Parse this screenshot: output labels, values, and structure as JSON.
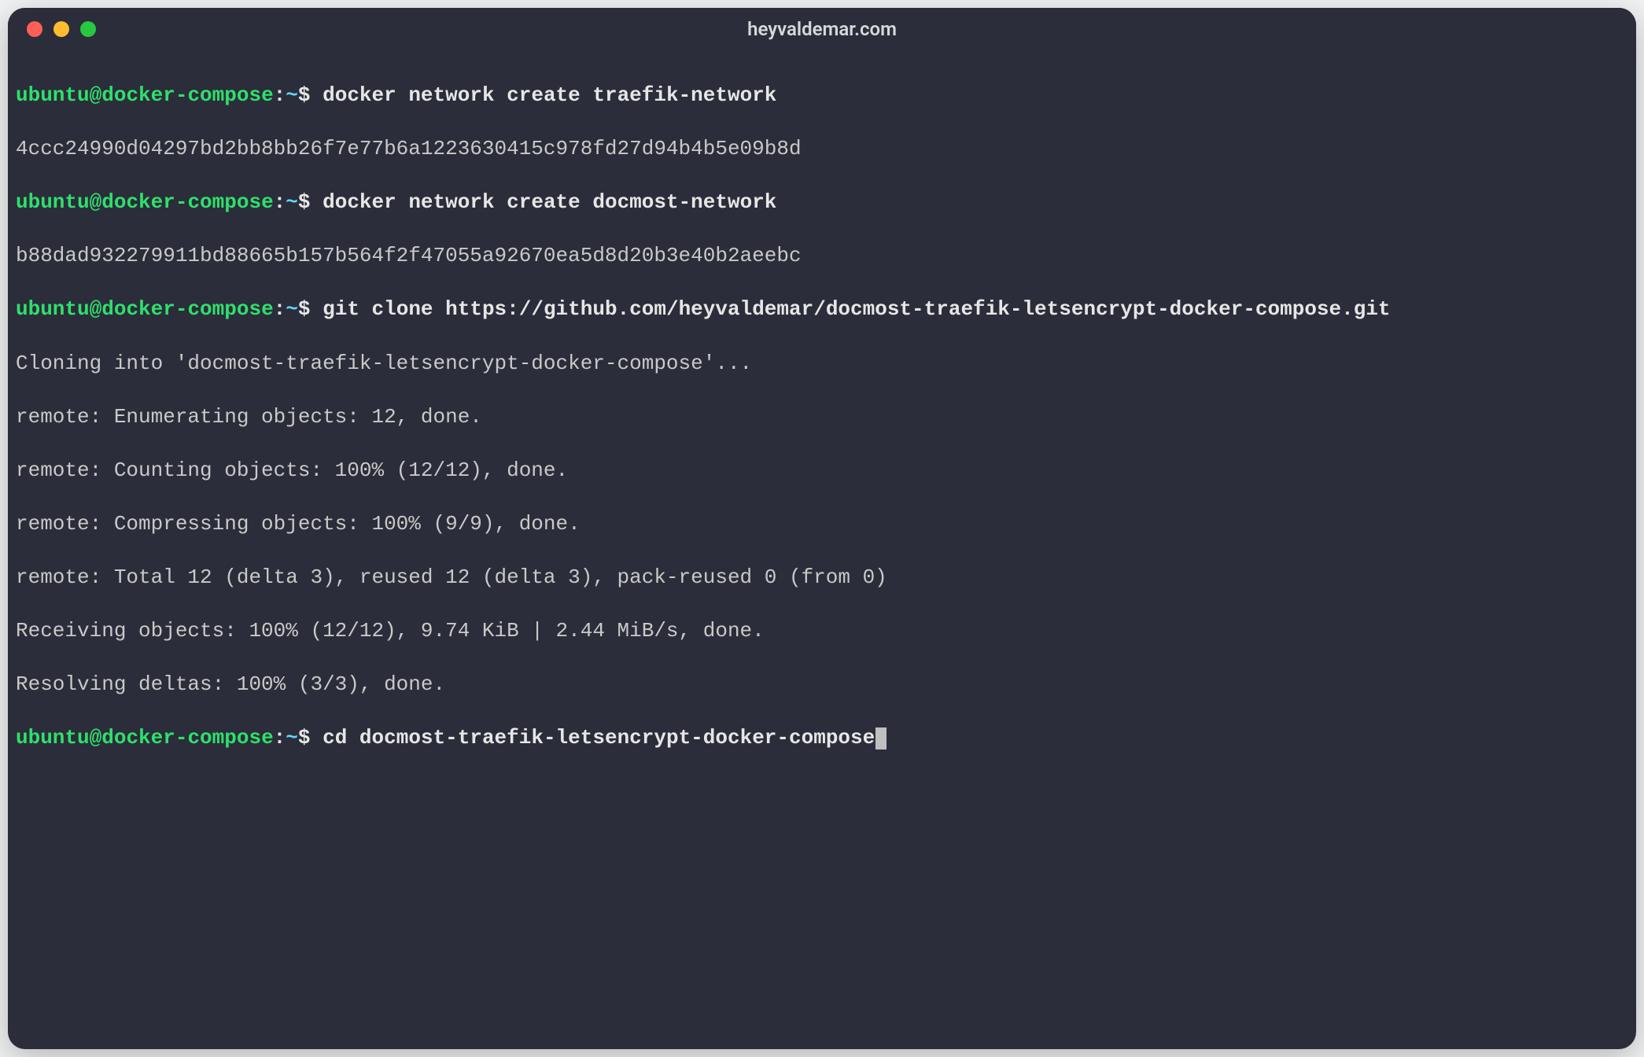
{
  "window": {
    "title": "heyvaldemar.com"
  },
  "prompt": {
    "user": "ubuntu",
    "at": "@",
    "host": "docker-compose",
    "colon": ":",
    "path": "~",
    "dollar": "$ "
  },
  "lines": {
    "cmd1": "docker network create traefik-network",
    "out1": "4ccc24990d04297bd2bb8bb26f7e77b6a1223630415c978fd27d94b4b5e09b8d",
    "cmd2": "docker network create docmost-network",
    "out2": "b88dad932279911bd88665b157b564f2f47055a92670ea5d8d20b3e40b2aeebc",
    "cmd3": "git clone https://github.com/heyvaldemar/docmost-traefik-letsencrypt-docker-compose.git",
    "out3": "Cloning into 'docmost-traefik-letsencrypt-docker-compose'...",
    "out4": "remote: Enumerating objects: 12, done.",
    "out5": "remote: Counting objects: 100% (12/12), done.",
    "out6": "remote: Compressing objects: 100% (9/9), done.",
    "out7": "remote: Total 12 (delta 3), reused 12 (delta 3), pack-reused 0 (from 0)",
    "out8": "Receiving objects: 100% (12/12), 9.74 KiB | 2.44 MiB/s, done.",
    "out9": "Resolving deltas: 100% (3/3), done.",
    "cmd4": "cd docmost-traefik-letsencrypt-docker-compose"
  }
}
